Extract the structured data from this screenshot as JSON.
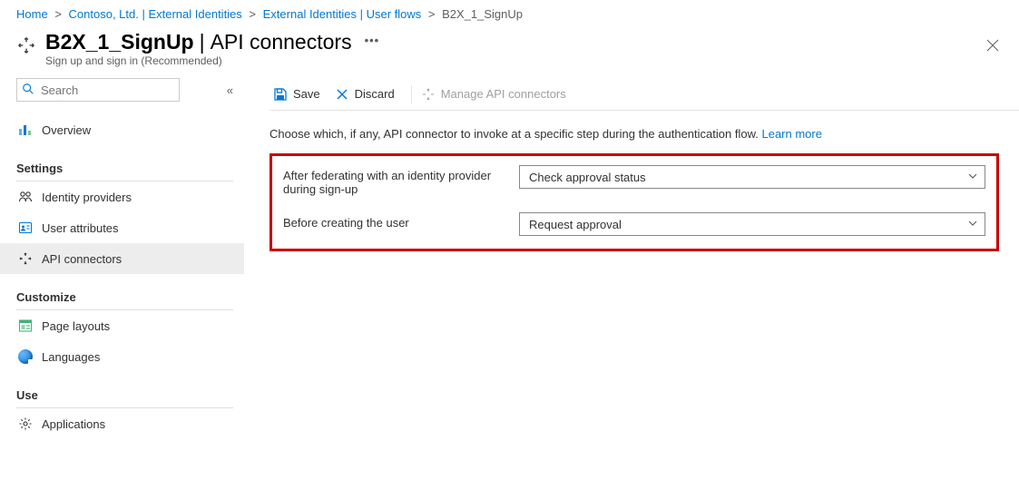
{
  "breadcrumb": [
    {
      "label": "Home",
      "link": true
    },
    {
      "label": "Contoso, Ltd. | External Identities",
      "link": true
    },
    {
      "label": "External Identities | User flows",
      "link": true
    },
    {
      "label": "B2X_1_SignUp",
      "link": false
    }
  ],
  "header": {
    "title_main": "B2X_1_SignUp",
    "title_sep": "|",
    "title_sub": "API connectors",
    "subtitle": "Sign up and sign in (Recommended)"
  },
  "search": {
    "placeholder": "Search"
  },
  "nav": {
    "overview": "Overview",
    "sections": {
      "settings": {
        "label": "Settings",
        "items": {
          "identity_providers": "Identity providers",
          "user_attributes": "User attributes",
          "api_connectors": "API connectors"
        }
      },
      "customize": {
        "label": "Customize",
        "items": {
          "page_layouts": "Page layouts",
          "languages": "Languages"
        }
      },
      "use": {
        "label": "Use",
        "items": {
          "applications": "Applications"
        }
      }
    }
  },
  "toolbar": {
    "save": "Save",
    "discard": "Discard",
    "manage": "Manage API connectors"
  },
  "content": {
    "intro": "Choose which, if any, API connector to invoke at a specific step during the authentication flow.",
    "learn_more": "Learn more",
    "field1": {
      "label": "After federating with an identity provider during sign-up",
      "value": "Check approval status"
    },
    "field2": {
      "label": "Before creating the user",
      "value": "Request approval"
    }
  }
}
